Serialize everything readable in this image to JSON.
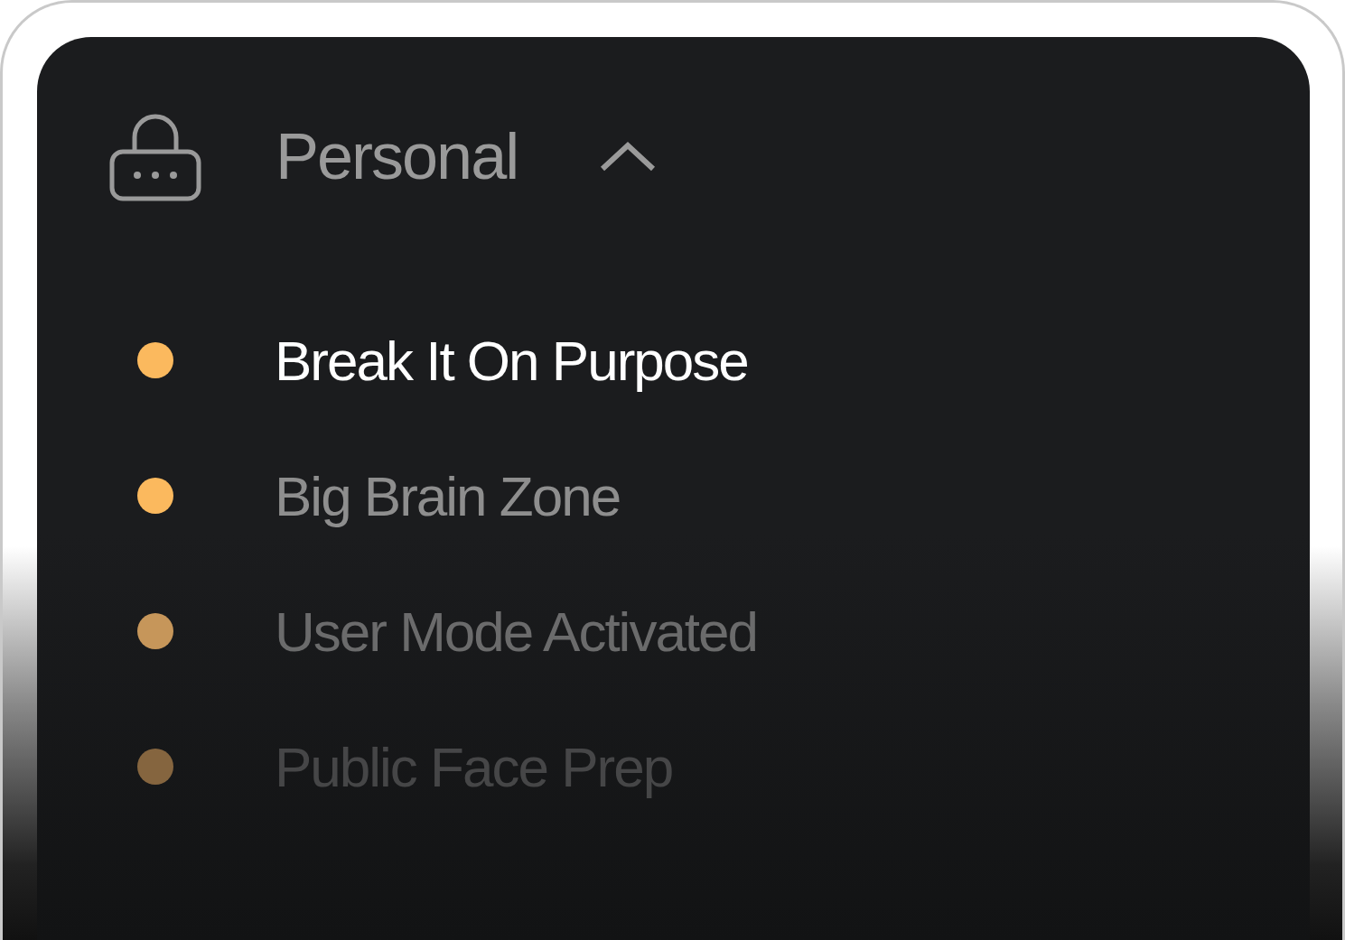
{
  "group": {
    "title": "Personal",
    "expanded": true,
    "items": [
      {
        "label": "Break It On Purpose",
        "selected": true,
        "color": "#fbb95e"
      },
      {
        "label": "Big Brain Zone",
        "selected": false,
        "color": "#fbb95e"
      },
      {
        "label": "User Mode Activated",
        "selected": false,
        "color": "#c6965a"
      },
      {
        "label": "Public Face Prep",
        "selected": false,
        "color": "#85653f"
      }
    ]
  }
}
